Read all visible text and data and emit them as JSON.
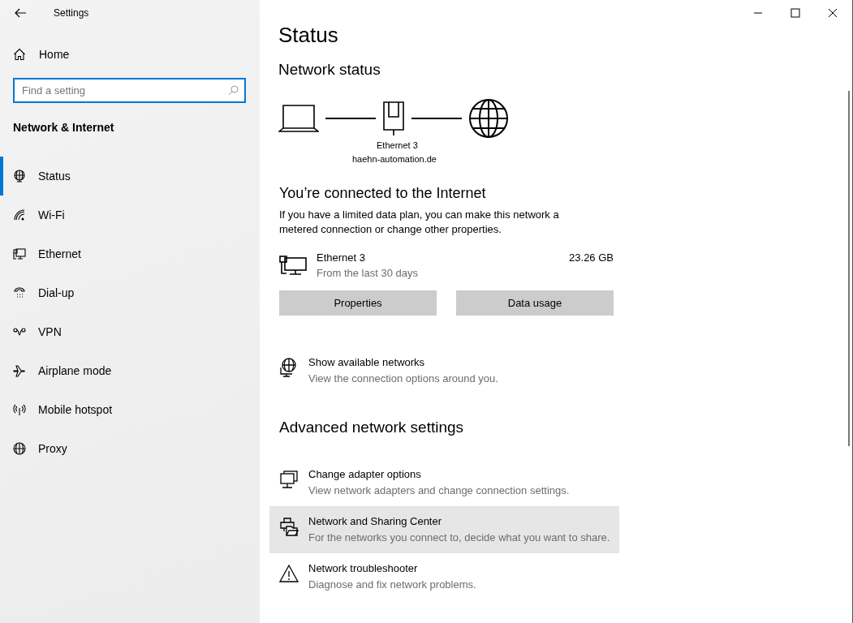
{
  "window": {
    "title": "Settings"
  },
  "sidebar": {
    "home": "Home",
    "search": {
      "placeholder": "Find a setting"
    },
    "section": "Network & Internet",
    "items": [
      {
        "label": "Status",
        "selected": true
      },
      {
        "label": "Wi-Fi",
        "selected": false
      },
      {
        "label": "Ethernet",
        "selected": false
      },
      {
        "label": "Dial-up",
        "selected": false
      },
      {
        "label": "VPN",
        "selected": false
      },
      {
        "label": "Airplane mode",
        "selected": false
      },
      {
        "label": "Mobile hotspot",
        "selected": false
      },
      {
        "label": "Proxy",
        "selected": false
      }
    ]
  },
  "page": {
    "title": "Status",
    "subtitle": "Network status",
    "diagram": {
      "adapter": "Ethernet 3",
      "network": "haehn-automation.de"
    },
    "connection_title": "You’re connected to the Internet",
    "connection_text": "If you have a limited data plan, you can make this network a metered connection or change other properties.",
    "usage": {
      "name": "Ethernet 3",
      "period": "From the last 30 days",
      "amount": "23.26 GB"
    },
    "buttons": [
      "Properties",
      "Data usage"
    ],
    "show_networks": {
      "title": "Show available networks",
      "description": "View the connection options around you."
    },
    "advanced_title": "Advanced network settings",
    "advanced": [
      {
        "title": "Change adapter options",
        "description": "View network adapters and change connection settings.",
        "highlighted": false
      },
      {
        "title": "Network and Sharing Center",
        "description": "For the networks you connect to, decide what you want to share.",
        "highlighted": true
      },
      {
        "title": "Network troubleshooter",
        "description": "Diagnose and fix network problems.",
        "highlighted": false
      }
    ]
  }
}
